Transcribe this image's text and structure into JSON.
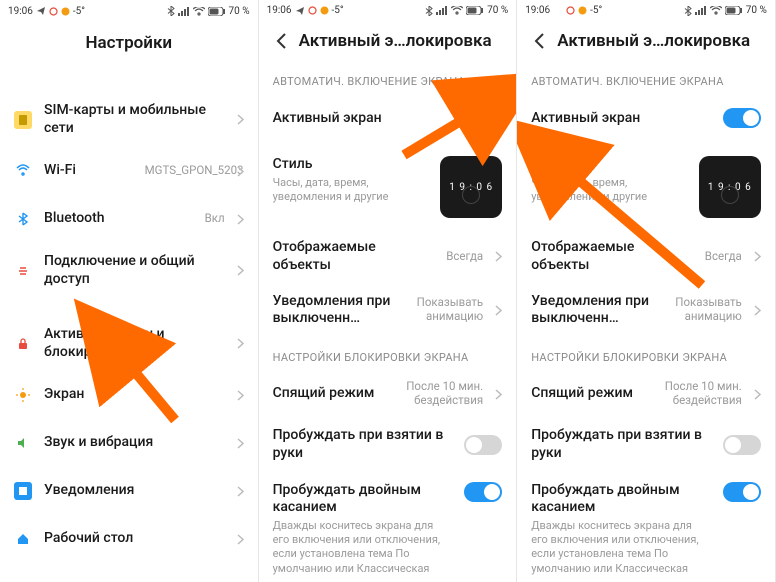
{
  "status": {
    "time": "19:06",
    "battery": "70 %",
    "temp": "-5°"
  },
  "panelA": {
    "title": "Настройки",
    "items": [
      {
        "label": "SIM-карты и мобильные сети",
        "value": ""
      },
      {
        "label": "Wi-Fi",
        "value": "MGTS_GPON_5203"
      },
      {
        "label": "Bluetooth",
        "value": "Вкл"
      },
      {
        "label": "Подключение и общий доступ",
        "value": ""
      },
      {
        "label": "Активный экран и блокировка",
        "value": ""
      },
      {
        "label": "Экран",
        "value": ""
      },
      {
        "label": "Звук и вибрация",
        "value": ""
      },
      {
        "label": "Уведомления",
        "value": ""
      },
      {
        "label": "Рабочий стол",
        "value": ""
      }
    ]
  },
  "panelB": {
    "title": "Активный э…локировка",
    "section1": "АВТОМАТИЧ. ВКЛЮЧЕНИЕ ЭКРАНА",
    "aod_label": "Активный экран",
    "aod_on": true,
    "style_label": "Стиль",
    "style_sub": "Часы, дата, время, уведомления и другие",
    "style_preview_time": "1 9 : 0 6",
    "objects_label": "Отображаемые объекты",
    "objects_value": "Всегда",
    "notif_label": "Уведомления при выключенн…",
    "notif_value": "Показывать анимацию",
    "section2": "НАСТРОЙКИ БЛОКИРОВКИ ЭКРАНА",
    "sleep_label": "Спящий режим",
    "sleep_value": "После 10 мин. бездействия",
    "raise_label": "Пробуждать при взятии в руки",
    "raise_on": false,
    "double_label": "Пробуждать двойным касанием",
    "double_sub": "Дважды коснитесь экрана для его включения или отключения, если установлена тема По умолчанию или Классическая",
    "double_on": true
  }
}
